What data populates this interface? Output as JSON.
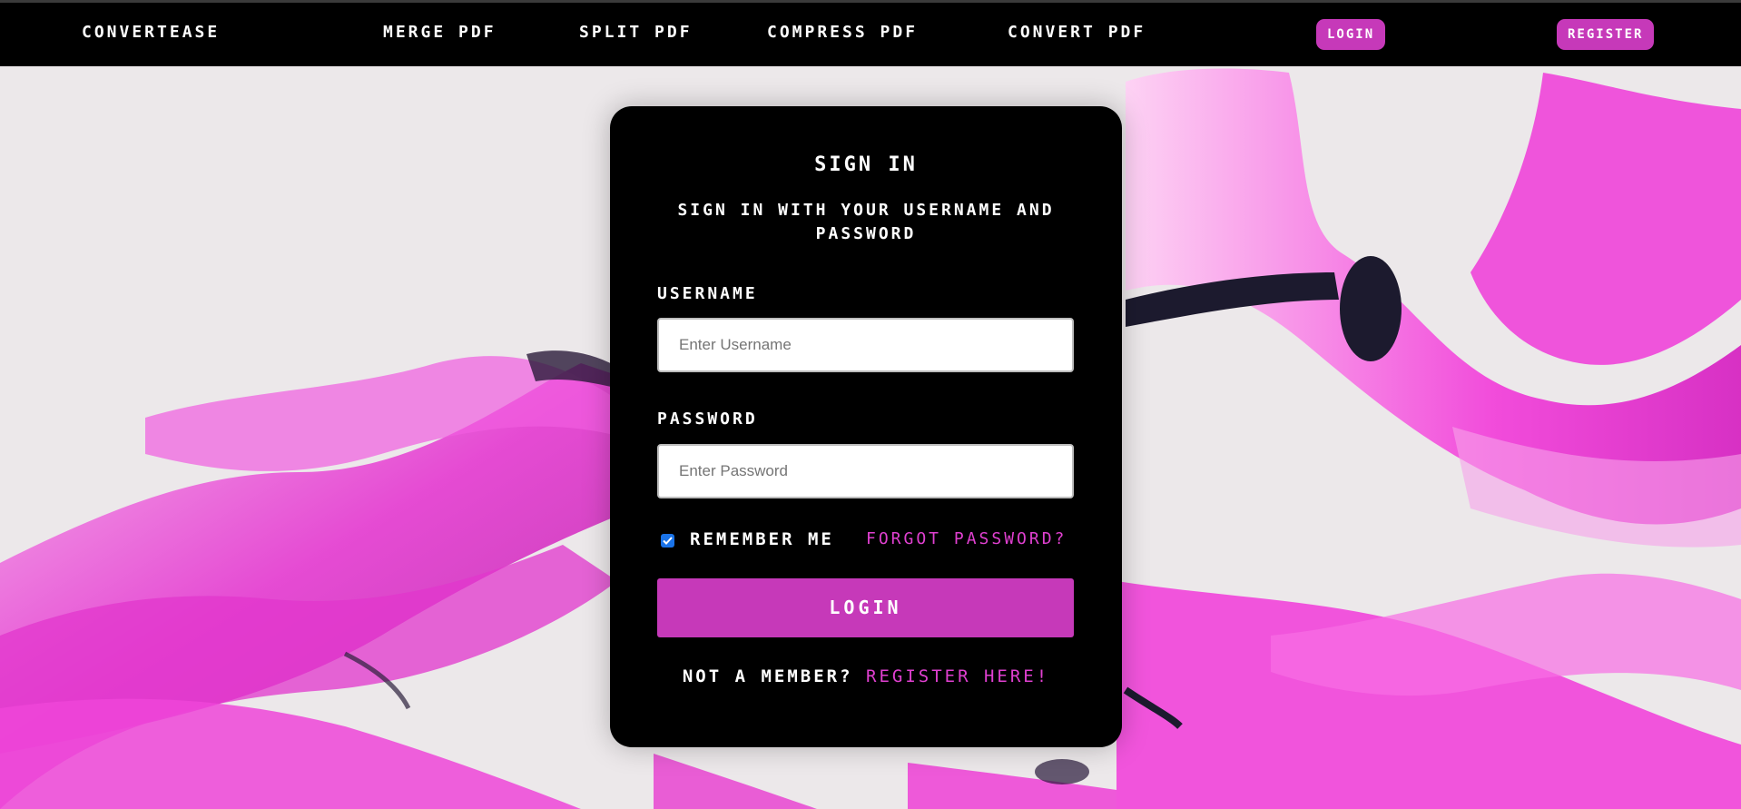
{
  "theme": {
    "accent": "#c639b9",
    "link": "#e040d0",
    "swirl_pink": "#f23ad9",
    "swirl_dark": "#1c1a2e"
  },
  "nav": {
    "brand": "ConvertEase",
    "links": [
      "Merge PDF",
      "Split PDF",
      "Compress PDF",
      "Convert PDF"
    ],
    "login_label": "Login",
    "register_label": "Register"
  },
  "form": {
    "title": "Sign In",
    "subtitle": "Sign in with your username and password",
    "username_label": "Username",
    "username_placeholder": "Enter Username",
    "username_value": "",
    "password_label": "Password",
    "password_placeholder": "Enter Password",
    "password_value": "",
    "remember_label": "Remember me",
    "remember_checked": true,
    "forgot_label": "Forgot password?",
    "submit_label": "Login",
    "signup_prompt": "Not a member?",
    "signup_link": "Register here!"
  }
}
